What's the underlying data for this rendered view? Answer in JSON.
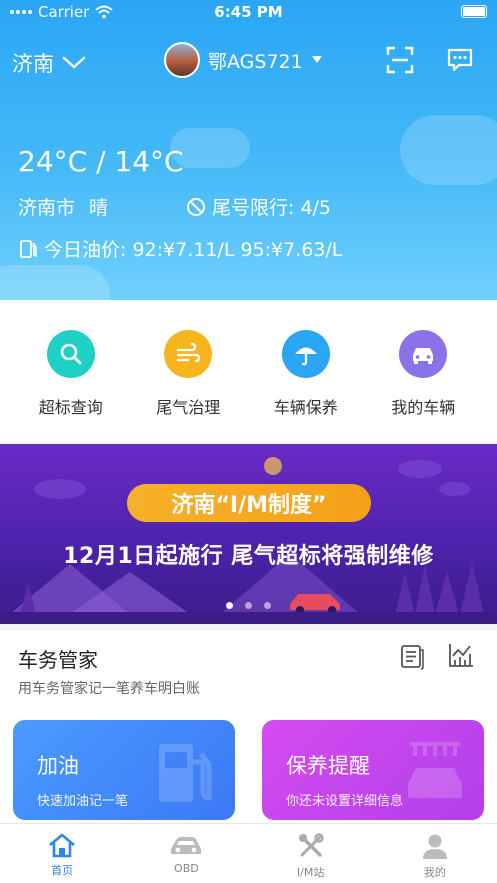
{
  "status": {
    "carrier": "Carrier",
    "time": "6:45 PM"
  },
  "header": {
    "city": "济南",
    "plate": "鄂AGS721"
  },
  "weather": {
    "temp": "24°C / 14°C",
    "city_name": "济南市",
    "condition": "晴",
    "limit": "尾号限行: 4/5",
    "oil": "今日油价: 92:¥7.11/L  95:¥7.63/L"
  },
  "quick_menu": [
    {
      "label": "超标查询",
      "icon": "search-icon",
      "color": "#1fd0c4"
    },
    {
      "label": "尾气治理",
      "icon": "wind-icon",
      "color": "#f6b51d"
    },
    {
      "label": "车辆保养",
      "icon": "umbrella-icon",
      "color": "#2aa6f5"
    },
    {
      "label": "我的车辆",
      "icon": "car-icon",
      "color": "#8a72ea"
    }
  ],
  "banner": {
    "pill": "济南“I/M制度”",
    "headline": "12月1日起施行  尾气超标将强制维修",
    "dots": 3,
    "active_dot": 0
  },
  "manager": {
    "title": "车务管家",
    "subtitle": "用车务管家记一笔养车明白账",
    "cards": [
      {
        "title": "加油",
        "subtitle": "快速加油记一笔"
      },
      {
        "title": "保养提醒",
        "subtitle": "你还未设置详细信息"
      }
    ]
  },
  "tabs": [
    {
      "label": "首页",
      "icon": "home-icon",
      "active": true
    },
    {
      "label": "OBD",
      "icon": "car-icon",
      "active": false
    },
    {
      "label": "I/M站",
      "icon": "tools-icon",
      "active": false
    },
    {
      "label": "我的",
      "icon": "profile-icon",
      "active": false
    }
  ],
  "colors": {
    "accent": "#2e86e8",
    "hero": "#2aa6f5",
    "banner": "#5a25b8",
    "pill": "#f5a019"
  }
}
